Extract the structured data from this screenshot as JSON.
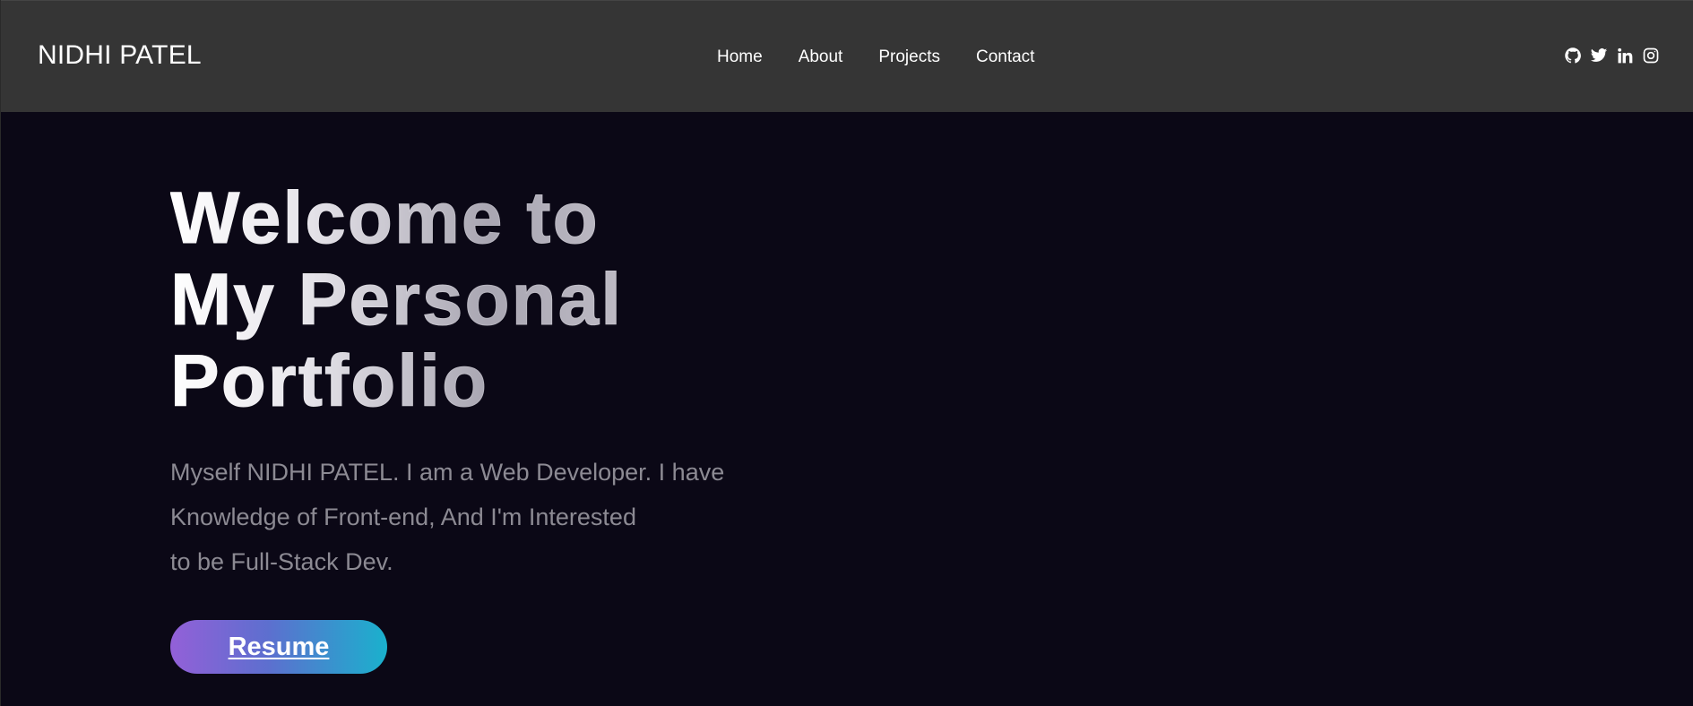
{
  "navbar": {
    "brand": "NIDHI PATEL",
    "links": [
      {
        "label": "Home"
      },
      {
        "label": "About"
      },
      {
        "label": "Projects"
      },
      {
        "label": "Contact"
      }
    ],
    "socials": [
      {
        "icon": "github-icon"
      },
      {
        "icon": "twitter-icon"
      },
      {
        "icon": "linkedin-icon"
      },
      {
        "icon": "instagram-icon"
      }
    ]
  },
  "hero": {
    "title_lines": [
      "Welcome to",
      "My Personal",
      "Portfolio"
    ],
    "description_lines": [
      "Myself NIDHI PATEL. I am a Web Developer. I have",
      "Knowledge of Front-end, And I'm Interested",
      "to be Full-Stack Dev."
    ],
    "resume_label": "Resume"
  },
  "colors": {
    "navbar_bg": "#353535",
    "page_bg": "#0b0816",
    "button_gradient_start": "#9360d8",
    "button_gradient_end": "#1ab1cd",
    "description_text": "#8c8a93"
  }
}
